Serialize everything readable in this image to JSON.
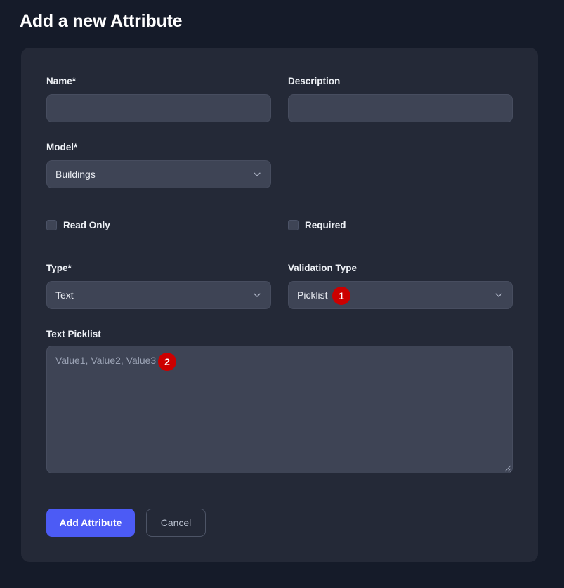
{
  "page": {
    "title": "Add a new Attribute"
  },
  "form": {
    "name": {
      "label": "Name*",
      "value": "",
      "placeholder": ""
    },
    "description": {
      "label": "Description",
      "value": "",
      "placeholder": ""
    },
    "model": {
      "label": "Model*",
      "selected": "Buildings",
      "icon": "chevron-down-icon"
    },
    "read_only": {
      "label": "Read Only",
      "checked": false
    },
    "required": {
      "label": "Required",
      "checked": false
    },
    "type": {
      "label": "Type*",
      "selected": "Text",
      "icon": "chevron-down-icon"
    },
    "validation_type": {
      "label": "Validation Type",
      "selected": "Picklist",
      "icon": "chevron-down-icon"
    },
    "text_picklist": {
      "label": "Text Picklist",
      "value": "",
      "placeholder": "Value1, Value2, Value3"
    }
  },
  "actions": {
    "submit_label": "Add Attribute",
    "cancel_label": "Cancel"
  },
  "annotations": [
    {
      "number": "1",
      "target": "validation-type-select"
    },
    {
      "number": "2",
      "target": "text-picklist-textarea"
    }
  ],
  "colors": {
    "page_background": "#151b29",
    "card_background": "#242937",
    "field_background": "#3e4455",
    "primary_button": "#4c5bf5",
    "badge": "#cc0000",
    "text": "#e7eaf0",
    "placeholder": "#9aa2b4"
  }
}
